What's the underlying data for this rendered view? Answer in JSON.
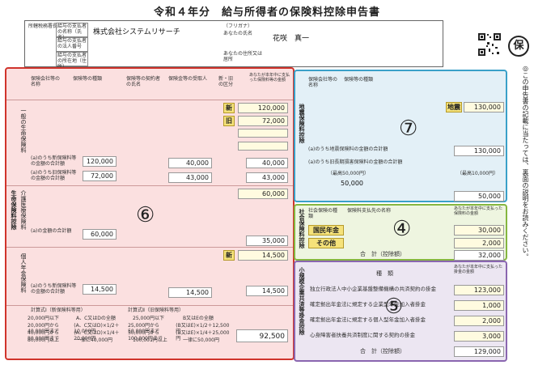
{
  "title": "令和４年分　給与所得者の保険料控除申告書",
  "header": {
    "office_label": "所轄税務署長",
    "employer_name_label": "給与の支払者の名称（氏名）",
    "employer_name": "株式会社システムリサーチ",
    "employer_number_label": "給与の支払者の法人番号",
    "employer_address_label": "給与の支払者の所在地（住所）",
    "furigana_label": "（フリガナ）",
    "your_name_label": "あなたの氏名",
    "your_name": "花咲　真一",
    "your_address_label": "あなたの住所又は居所",
    "stamp_char": "保"
  },
  "life": {
    "section_label": "生命保険料控除",
    "col_company": "保険会社等の名称",
    "col_type": "保険等の種類",
    "col_contract": "保険等の契約者の氏名",
    "col_receiver": "保険金等の受取人",
    "col_new_old": "新・旧の区分",
    "col_amount": "あなたが本年中に支払った保険料等の金額",
    "row_labels": [
      "一般の生命保険料",
      "介護医療保険料",
      "個人年金保険料"
    ],
    "badges": [
      "新",
      "旧",
      "新"
    ],
    "values": [
      "120,000",
      "72,000",
      "60,000",
      "14,500"
    ],
    "sum_A_label": "(a)のうち新保険料等の金額の合計額",
    "sum_A": "120,000",
    "sum_B_label": "(a)のうち旧保険料等の金額の合計額",
    "sum_B": "72,000",
    "calc1": "40,000",
    "calc2": "43,000",
    "calc_total": "40,000",
    "calc_total2": "43,000",
    "sum_C_label": "(a)の金額の合計額",
    "sum_C": "60,000",
    "care_result": "35,000",
    "sum_D_label": "(a)のうち新保険料等の金額の合計額",
    "sum_D": "14,500",
    "pension_calc": "14,500",
    "pension_total": "14,500",
    "life_total": "92,500",
    "table_header_a": "計算式Ⅰ（新保険料等用）",
    "table_header_b": "計算式Ⅱ（旧保険料等用）",
    "table_rows": [
      [
        "20,000円以下",
        "A、C又はDの全額",
        "25,000円以下",
        "B又はEの全額"
      ],
      [
        "20,000円から40,000円まで",
        "(A、C又はD)×1/2＋10,000円",
        "25,000円から50,000円まで",
        "(B又はE)×1/2＋12,500円"
      ],
      [
        "40,000円から80,000円まで",
        "(A、C又はD)×1/4＋20,000円",
        "50,000円から100,000円まで",
        "(B又はE)×1/4＋25,000円"
      ],
      [
        "80,000円以上",
        "一律に40,000円",
        "100,001円以上",
        "一律に50,000円"
      ]
    ]
  },
  "earthquake": {
    "section_label": "地震保険料控除",
    "col_company": "保険会社等の名称",
    "col_type": "保険等の種類",
    "badge": "地震",
    "value": "130,000",
    "line1": "(a)のうち地震保険料の金額の合計額",
    "line1_value": "130,000",
    "line2": "(a)のうち旧長期損害保険料の金額の合計額",
    "limit1": "（最高50,000円）",
    "limit1_value": "50,000",
    "limit2": "（最高10,000円）",
    "result": "50,000"
  },
  "social": {
    "section_label": "社会保険料控除",
    "col_type": "社会保険の種類",
    "col_payer": "保険料支払先の名称",
    "col_amount": "あなたが本年中に支払った保険料の金額",
    "items": [
      {
        "type": "国民年金",
        "amount": "30,000"
      },
      {
        "type": "その他",
        "amount": "2,000"
      }
    ],
    "total_label": "合　計（控除額）",
    "total": "32,000"
  },
  "small": {
    "section_label": "小規模企業共済等掛金控除",
    "col_type": "種　類",
    "col_amount": "あなたが本年中に支払った掛金の金額",
    "items": [
      {
        "label": "独立行政法人中小企業基盤整備機構の共済契約の掛金",
        "amount": "123,000"
      },
      {
        "label": "確定拠出年金法に規定する企業型年金加入者掛金",
        "amount": "1,000"
      },
      {
        "label": "確定拠出年金法に規定する個人型年金加入者掛金",
        "amount": "2,000"
      },
      {
        "label": "心身障害者扶養共済制度に関する契約の掛金",
        "amount": "3,000"
      }
    ],
    "total_label": "合　計（控除額）",
    "total": "129,000"
  },
  "markers": {
    "red": "⑥",
    "blue": "⑦",
    "green": "④",
    "purple": "⑤"
  },
  "side_note": "◎この申告書の記載に当たっては、裏面の説明をお読みください。",
  "colors": {
    "red": "#d0342c",
    "blue": "#39a0c8",
    "green": "#85b640",
    "purple": "#8a66b0",
    "input": "#f5e27a"
  }
}
